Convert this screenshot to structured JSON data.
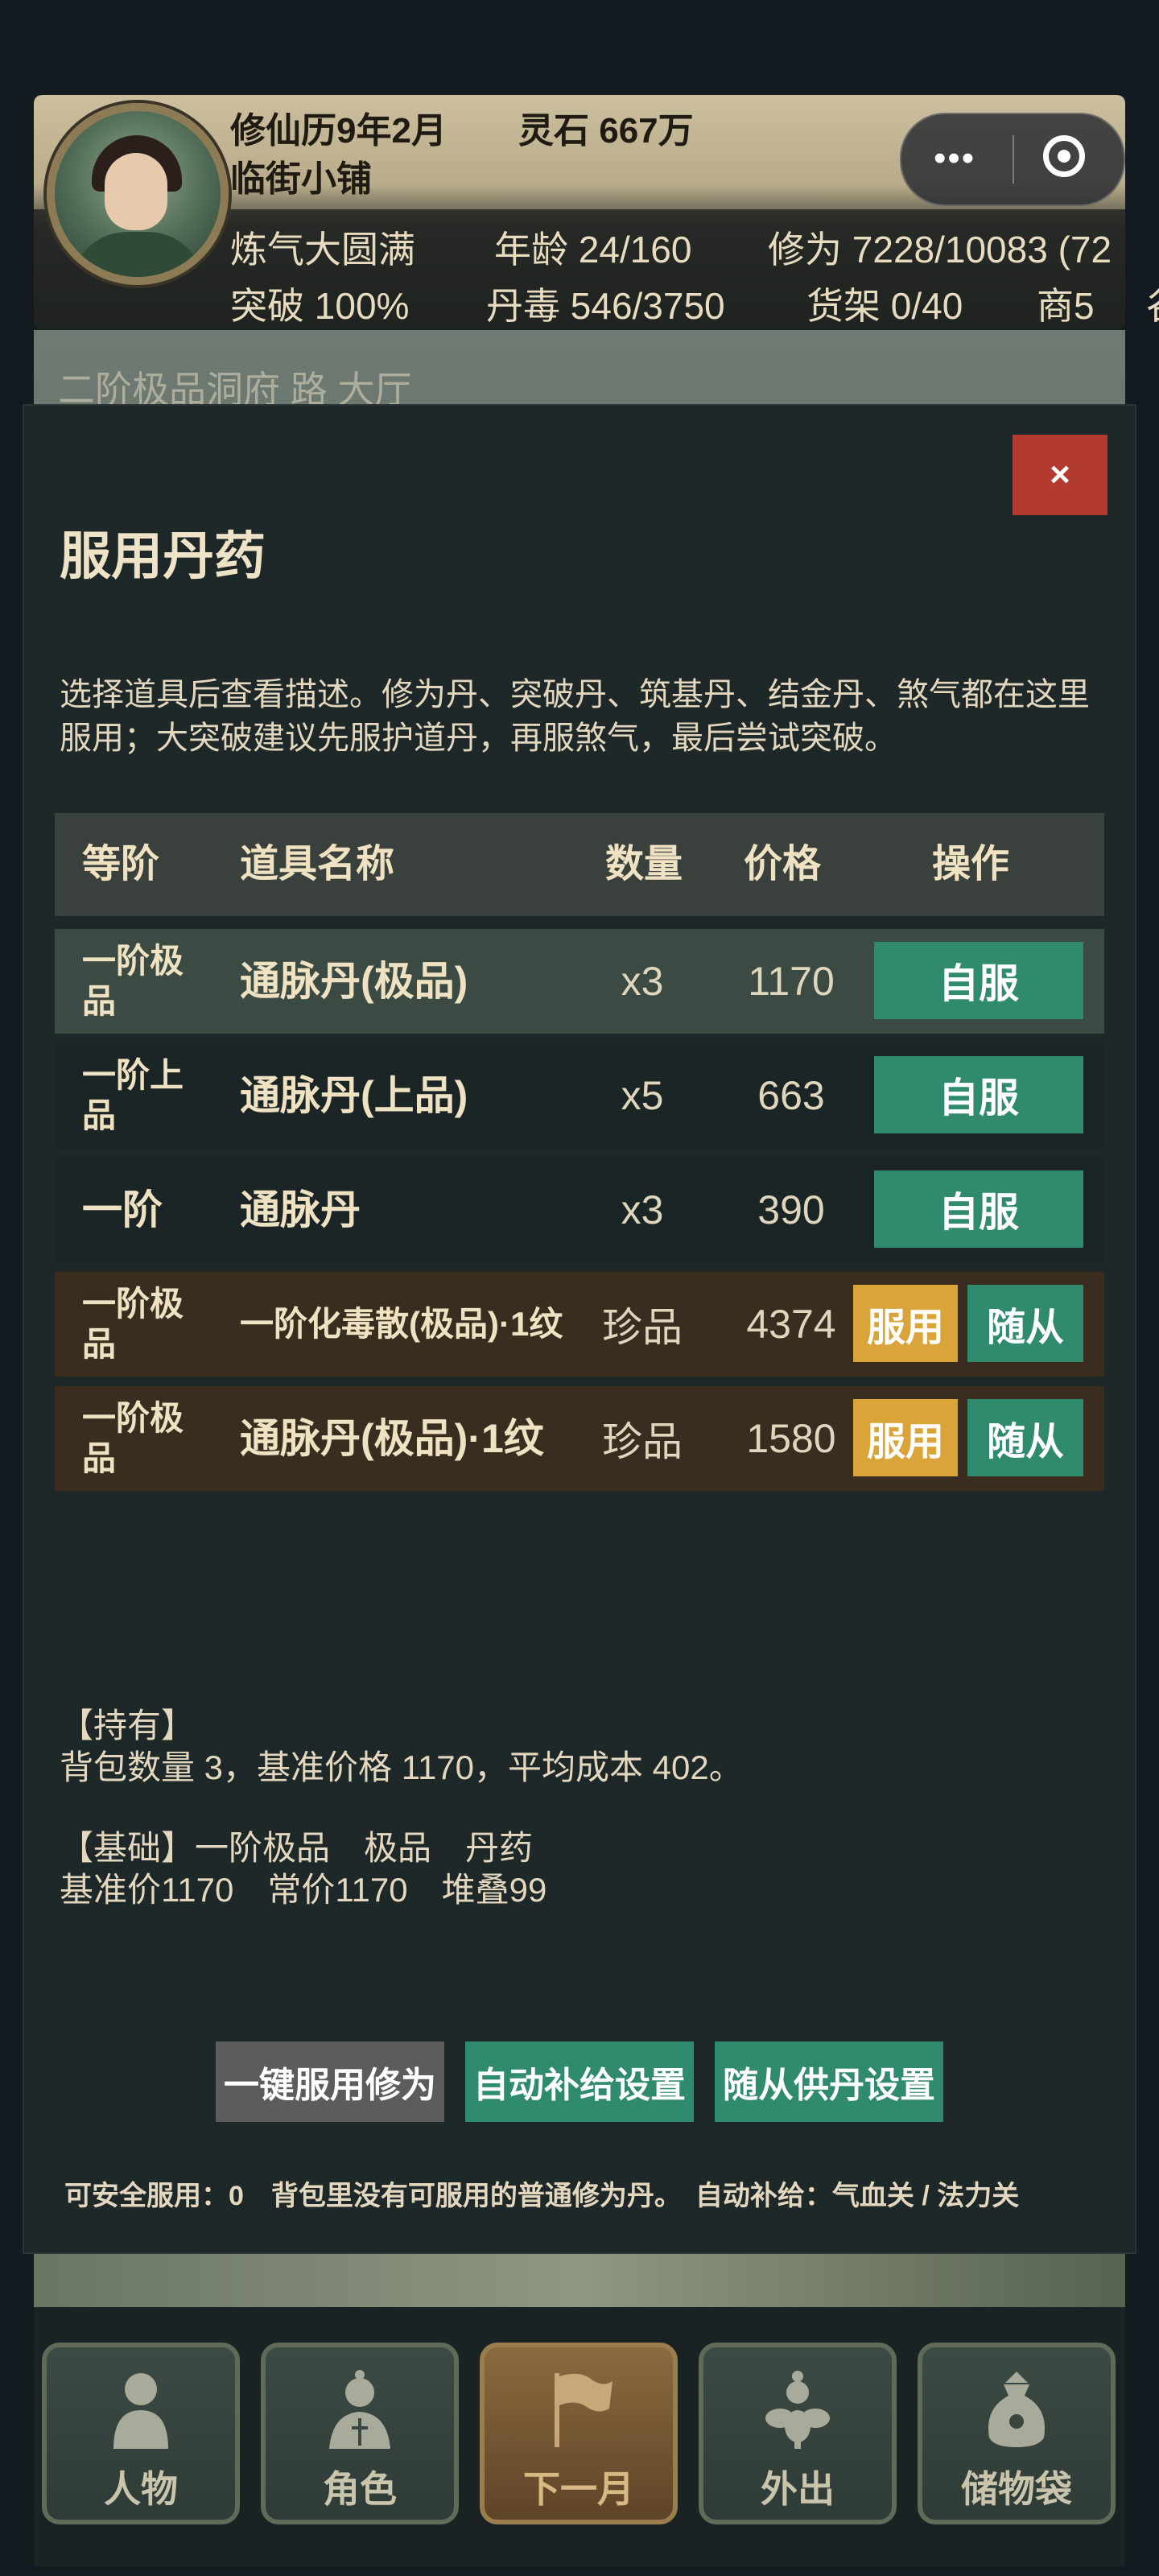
{
  "header": {
    "calendar": "修仙历9年2月",
    "spirit_stone": "灵石 667万",
    "shop_name": "临街小铺",
    "realm": "炼气大圆满",
    "age": "年龄 24/160",
    "cultivation": "修为 7228/10083 (72",
    "breakthrough": "突破 100%",
    "pill_poison": "丹毒 546/3750",
    "shelf": "货架 0/40",
    "merchant": "商5",
    "overflow_char": "谷"
  },
  "scene": {
    "label": "二阶极品洞府 路 大厅"
  },
  "modal": {
    "close_label": "×",
    "title": "服用丹药",
    "description": "选择道具后查看描述。修为丹、突破丹、筑基丹、结金丹、煞气都在这里服用；大突破建议先服护道丹，再服煞气，最后尝试突破。",
    "table": {
      "headers": {
        "tier": "等阶",
        "name": "道具名称",
        "qty": "数量",
        "price": "价格",
        "action": "操作"
      },
      "rows": [
        {
          "tier": "一阶极品",
          "name": "通脉丹(极品)",
          "qty": "x3",
          "price": "1170",
          "action": "自服"
        },
        {
          "tier": "一阶上品",
          "name": "通脉丹(上品)",
          "qty": "x5",
          "price": "663",
          "action": "自服"
        },
        {
          "tier": "一阶",
          "name": "通脉丹",
          "qty": "x3",
          "price": "390",
          "action": "自服"
        },
        {
          "tier": "一阶极品",
          "name": "一阶化毒散(极品)·1纹",
          "qty": "珍品",
          "price": "4374",
          "action_use": "服用",
          "action_follow": "随从"
        },
        {
          "tier": "一阶极品",
          "name": "通脉丹(极品)·1纹",
          "qty": "珍品",
          "price": "1580",
          "action_use": "服用",
          "action_follow": "随从"
        }
      ]
    },
    "holding_title": "【持有】",
    "holding_text": "背包数量 3，基准价格 1170，平均成本 402。",
    "basic_title": "【基础】一阶极品　极品　丹药",
    "basic_text": "基准价1170　常价1170　堆叠99",
    "buttons": {
      "one_click": "一键服用修为",
      "auto_supply": "自动补给设置",
      "follower_supply": "随从供丹设置"
    },
    "footer_note": "可安全服用：0　背包里没有可服用的普通修为丹。　自动补给：气血关 / 法力关"
  },
  "nav": [
    {
      "label": "人物",
      "icon": "person-bust-icon"
    },
    {
      "label": "角色",
      "icon": "robed-figure-icon"
    },
    {
      "label": "下一月",
      "icon": "flag-icon"
    },
    {
      "label": "外出",
      "icon": "flower-figure-icon"
    },
    {
      "label": "储物袋",
      "icon": "storage-bag-icon"
    }
  ],
  "colors": {
    "modal_bg": "#1f2828",
    "close_red": "#b23a2e",
    "action_green": "#2f8a6e",
    "use_gold": "#d9a53a",
    "one_click_gray": "#5c5c5c"
  }
}
